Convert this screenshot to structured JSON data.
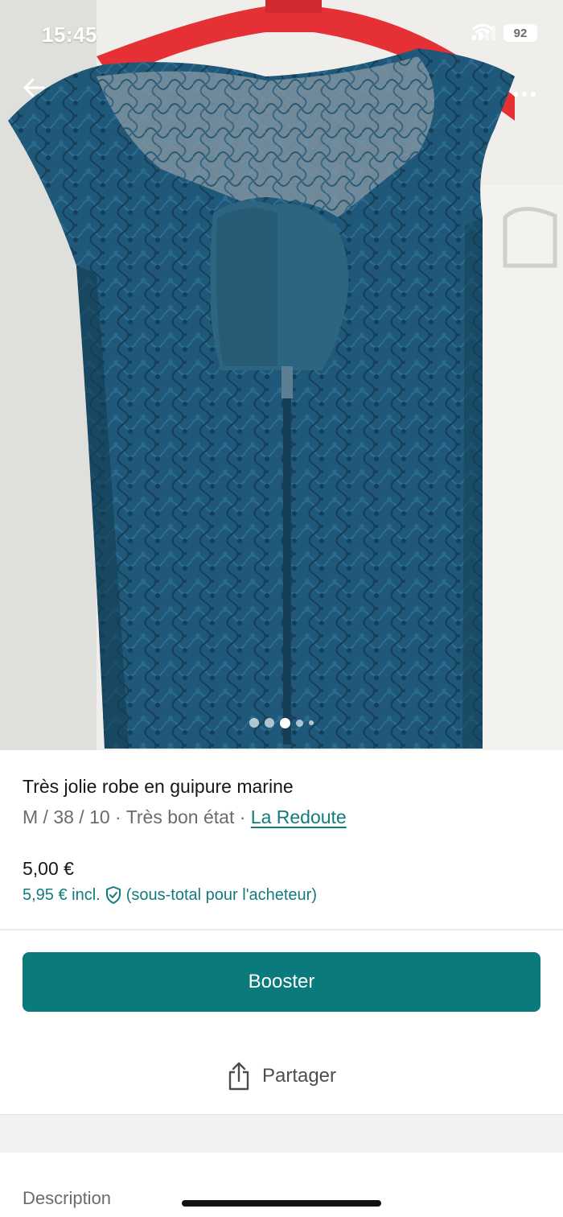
{
  "status_bar": {
    "time": "15:45",
    "battery": "92"
  },
  "photo": {
    "subject": "blue lace dress on red hanger",
    "dress_color": "#1f5878",
    "hanger_color": "#e53036",
    "gallery_count": 5,
    "gallery_current_index": 2
  },
  "nav": {
    "back_icon": "arrow-left-icon",
    "more_icon": "more-horizontal-icon"
  },
  "listing": {
    "title": "Très jolie robe en guipure marine",
    "meta_prefix": "M / 38 / 10 · Très bon état · ",
    "brand": "La Redoute",
    "price": "5,00 €",
    "price_incl": "5,95 € incl.",
    "price_incl_note": "(sous-total pour l'acheteur)"
  },
  "actions": {
    "booster_label": "Booster",
    "share_label": "Partager"
  },
  "sections": {
    "description_label": "Description"
  },
  "colors": {
    "accent": "#0b7a7d",
    "link": "#127b7d",
    "text_primary": "#171717",
    "text_secondary": "#6b6b6b"
  }
}
